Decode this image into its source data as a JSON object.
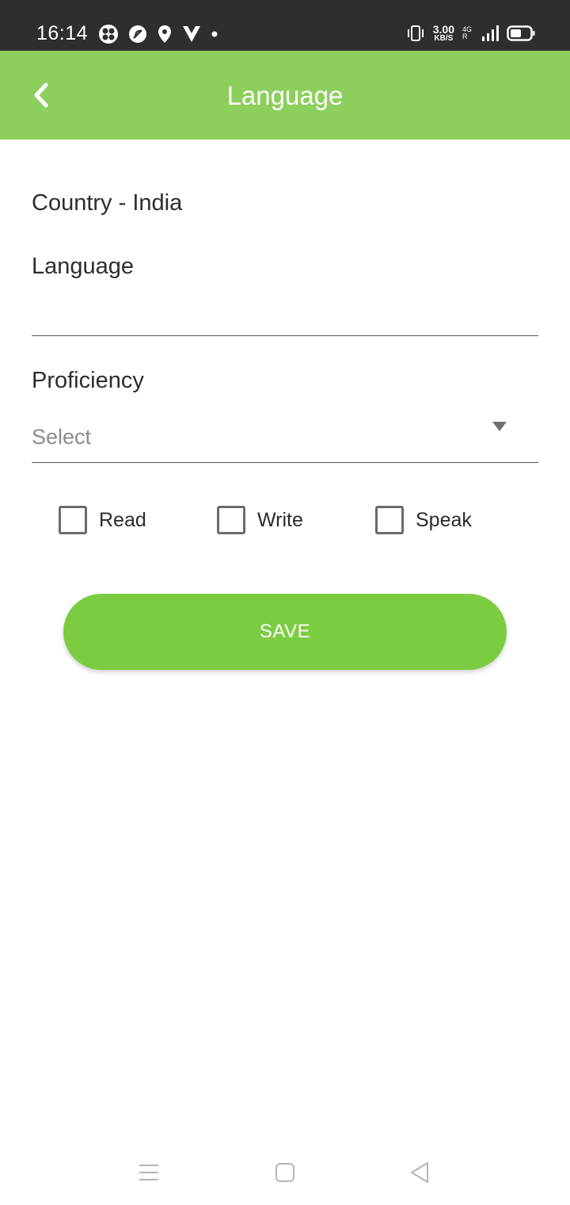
{
  "status_bar": {
    "time": "16:14",
    "speed_value": "3.00",
    "speed_unit": "KB/S",
    "network_top": "4G",
    "network_bottom": "R"
  },
  "app_bar": {
    "title": "Language"
  },
  "form": {
    "country_label": "Country - India",
    "language_label": "Language",
    "language_value": "",
    "proficiency_label": "Proficiency",
    "proficiency_selected": "Select"
  },
  "checkboxes": [
    {
      "label": "Read",
      "checked": false
    },
    {
      "label": "Write",
      "checked": false
    },
    {
      "label": "Speak",
      "checked": false
    }
  ],
  "save_button": {
    "label": "SAVE"
  },
  "colors": {
    "app_bar": "#8ccf5c",
    "save_button": "#7ccc42",
    "status_bar": "#2e2e2e"
  },
  "icons": {
    "back": "chevron-left-icon",
    "dropdown": "triangle-down-icon",
    "nav_menu": "menu-icon",
    "nav_home": "square-icon",
    "nav_back": "triangle-left-icon"
  }
}
